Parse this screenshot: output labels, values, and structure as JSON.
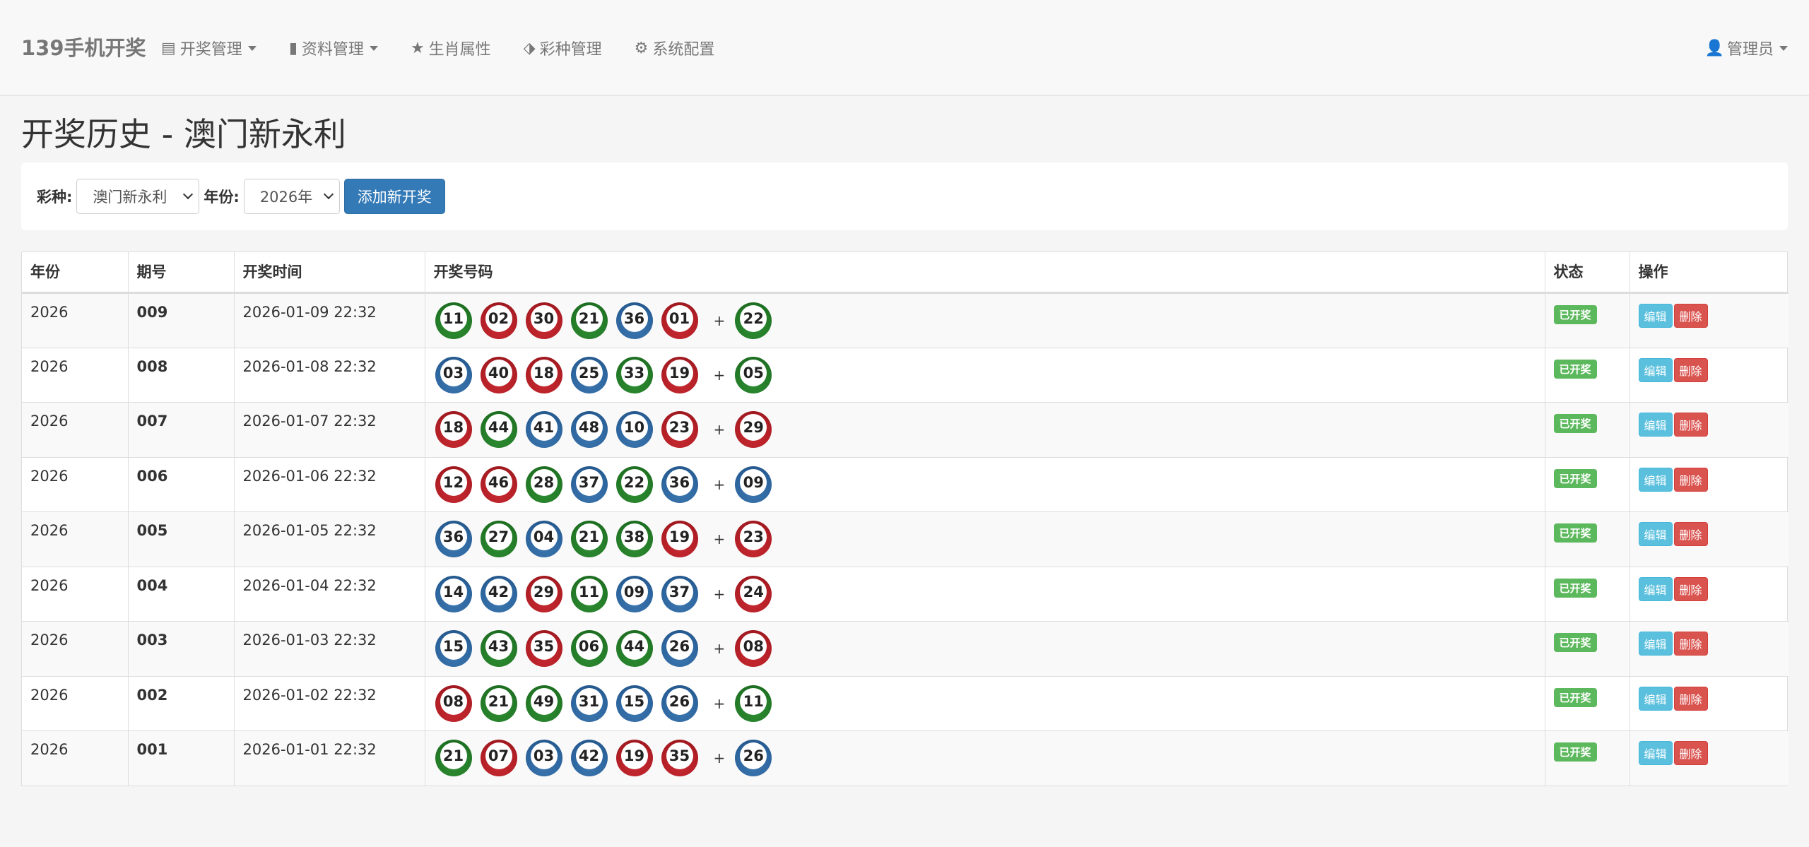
{
  "brand": "139手机开奖",
  "nav": {
    "items": [
      {
        "icon": "list-icon",
        "glyph": "▤",
        "label": "开奖管理",
        "dropdown": true
      },
      {
        "icon": "book-icon",
        "glyph": "▮",
        "label": "资料管理",
        "dropdown": true
      },
      {
        "icon": "star-icon",
        "glyph": "★",
        "label": "生肖属性",
        "dropdown": false
      },
      {
        "icon": "tags-icon",
        "glyph": "⬗",
        "label": "彩种管理",
        "dropdown": false
      },
      {
        "icon": "gear-icon",
        "glyph": "⚙",
        "label": "系统配置",
        "dropdown": false
      }
    ],
    "user": {
      "icon": "user-icon",
      "glyph": "👤",
      "label": "管理员"
    }
  },
  "page": {
    "title": "开奖历史 - 澳门新永利"
  },
  "filter": {
    "lottery_label": "彩种:",
    "lottery_value": "澳门新永利",
    "year_label": "年份:",
    "year_value": "2026年",
    "add_button": "添加新开奖"
  },
  "colors": {
    "red": "#b21f26",
    "blue": "#2d659e",
    "green": "#237a27",
    "primary": "#337ab7",
    "success": "#5cb85c",
    "info": "#5bc0de",
    "danger": "#d9534f"
  },
  "table": {
    "headers": [
      "年份",
      "期号",
      "开奖时间",
      "开奖号码",
      "状态",
      "操作"
    ],
    "plus": "+",
    "status_label": "已开奖",
    "edit_label": "编辑",
    "delete_label": "删除",
    "rows": [
      {
        "year": "2026",
        "issue": "009",
        "time": "2026-01-09 22:32",
        "balls": [
          {
            "n": "11",
            "c": "green"
          },
          {
            "n": "02",
            "c": "red"
          },
          {
            "n": "30",
            "c": "red"
          },
          {
            "n": "21",
            "c": "green"
          },
          {
            "n": "36",
            "c": "blue"
          },
          {
            "n": "01",
            "c": "red"
          }
        ],
        "special": {
          "n": "22",
          "c": "green"
        }
      },
      {
        "year": "2026",
        "issue": "008",
        "time": "2026-01-08 22:32",
        "balls": [
          {
            "n": "03",
            "c": "blue"
          },
          {
            "n": "40",
            "c": "red"
          },
          {
            "n": "18",
            "c": "red"
          },
          {
            "n": "25",
            "c": "blue"
          },
          {
            "n": "33",
            "c": "green"
          },
          {
            "n": "19",
            "c": "red"
          }
        ],
        "special": {
          "n": "05",
          "c": "green"
        }
      },
      {
        "year": "2026",
        "issue": "007",
        "time": "2026-01-07 22:32",
        "balls": [
          {
            "n": "18",
            "c": "red"
          },
          {
            "n": "44",
            "c": "green"
          },
          {
            "n": "41",
            "c": "blue"
          },
          {
            "n": "48",
            "c": "blue"
          },
          {
            "n": "10",
            "c": "blue"
          },
          {
            "n": "23",
            "c": "red"
          }
        ],
        "special": {
          "n": "29",
          "c": "red"
        }
      },
      {
        "year": "2026",
        "issue": "006",
        "time": "2026-01-06 22:32",
        "balls": [
          {
            "n": "12",
            "c": "red"
          },
          {
            "n": "46",
            "c": "red"
          },
          {
            "n": "28",
            "c": "green"
          },
          {
            "n": "37",
            "c": "blue"
          },
          {
            "n": "22",
            "c": "green"
          },
          {
            "n": "36",
            "c": "blue"
          }
        ],
        "special": {
          "n": "09",
          "c": "blue"
        }
      },
      {
        "year": "2026",
        "issue": "005",
        "time": "2026-01-05 22:32",
        "balls": [
          {
            "n": "36",
            "c": "blue"
          },
          {
            "n": "27",
            "c": "green"
          },
          {
            "n": "04",
            "c": "blue"
          },
          {
            "n": "21",
            "c": "green"
          },
          {
            "n": "38",
            "c": "green"
          },
          {
            "n": "19",
            "c": "red"
          }
        ],
        "special": {
          "n": "23",
          "c": "red"
        }
      },
      {
        "year": "2026",
        "issue": "004",
        "time": "2026-01-04 22:32",
        "balls": [
          {
            "n": "14",
            "c": "blue"
          },
          {
            "n": "42",
            "c": "blue"
          },
          {
            "n": "29",
            "c": "red"
          },
          {
            "n": "11",
            "c": "green"
          },
          {
            "n": "09",
            "c": "blue"
          },
          {
            "n": "37",
            "c": "blue"
          }
        ],
        "special": {
          "n": "24",
          "c": "red"
        }
      },
      {
        "year": "2026",
        "issue": "003",
        "time": "2026-01-03 22:32",
        "balls": [
          {
            "n": "15",
            "c": "blue"
          },
          {
            "n": "43",
            "c": "green"
          },
          {
            "n": "35",
            "c": "red"
          },
          {
            "n": "06",
            "c": "green"
          },
          {
            "n": "44",
            "c": "green"
          },
          {
            "n": "26",
            "c": "blue"
          }
        ],
        "special": {
          "n": "08",
          "c": "red"
        }
      },
      {
        "year": "2026",
        "issue": "002",
        "time": "2026-01-02 22:32",
        "balls": [
          {
            "n": "08",
            "c": "red"
          },
          {
            "n": "21",
            "c": "green"
          },
          {
            "n": "49",
            "c": "green"
          },
          {
            "n": "31",
            "c": "blue"
          },
          {
            "n": "15",
            "c": "blue"
          },
          {
            "n": "26",
            "c": "blue"
          }
        ],
        "special": {
          "n": "11",
          "c": "green"
        }
      },
      {
        "year": "2026",
        "issue": "001",
        "time": "2026-01-01 22:32",
        "balls": [
          {
            "n": "21",
            "c": "green"
          },
          {
            "n": "07",
            "c": "red"
          },
          {
            "n": "03",
            "c": "blue"
          },
          {
            "n": "42",
            "c": "blue"
          },
          {
            "n": "19",
            "c": "red"
          },
          {
            "n": "35",
            "c": "red"
          }
        ],
        "special": {
          "n": "26",
          "c": "blue"
        }
      }
    ]
  }
}
